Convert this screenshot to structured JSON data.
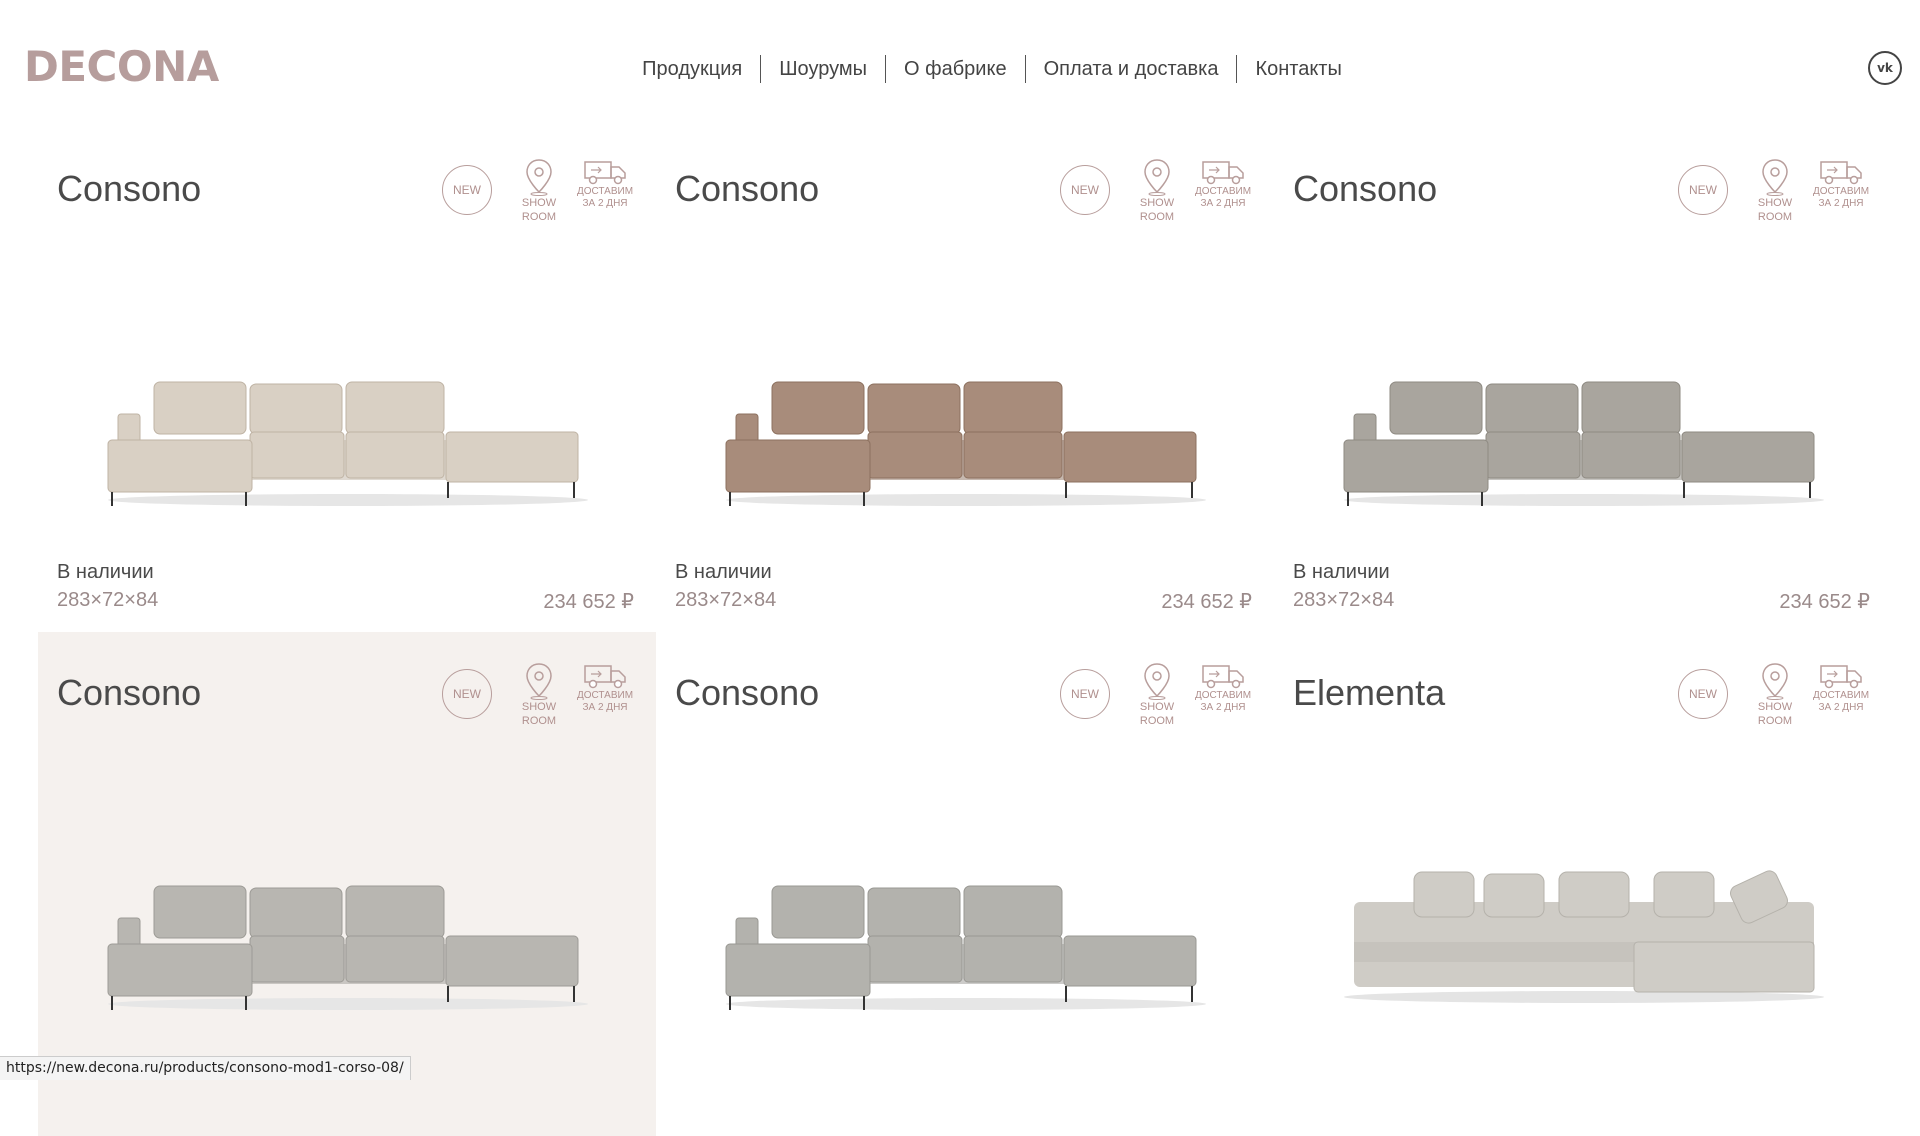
{
  "brand": "DECONA",
  "nav": [
    "Продукция",
    "Шоурумы",
    "О фабрике",
    "Оплата и доставка",
    "Контакты"
  ],
  "social": "vk",
  "badges": {
    "new": "NEW",
    "show1": "SHOW",
    "show2": "ROOM",
    "deliv1": "ДОСТАВИМ",
    "deliv2": "ЗА 2 ДНЯ"
  },
  "products": [
    {
      "title": "Consono",
      "stock": "В наличии",
      "dims": "283×72×84",
      "price": "234 652 ₽",
      "color": "#d9d0c4",
      "dark": "#bfb3a4"
    },
    {
      "title": "Consono",
      "stock": "В наличии",
      "dims": "283×72×84",
      "price": "234 652 ₽",
      "color": "#a88c7b",
      "dark": "#8d715f"
    },
    {
      "title": "Consono",
      "stock": "В наличии",
      "dims": "283×72×84",
      "price": "234 652 ₽",
      "color": "#a9a59e",
      "dark": "#8e8a82"
    },
    {
      "title": "Consono",
      "stock": "",
      "dims": "",
      "price": "",
      "color": "#b8b6b1",
      "dark": "#9d9b96"
    },
    {
      "title": "Consono",
      "stock": "",
      "dims": "",
      "price": "",
      "color": "#b3b2ad",
      "dark": "#999893"
    },
    {
      "title": "Elementa",
      "stock": "",
      "dims": "",
      "price": "",
      "color": "#cfccc6",
      "dark": "#b5b2ab"
    }
  ],
  "status_url": "https://new.decona.ru/products/consono-mod1-corso-08/"
}
